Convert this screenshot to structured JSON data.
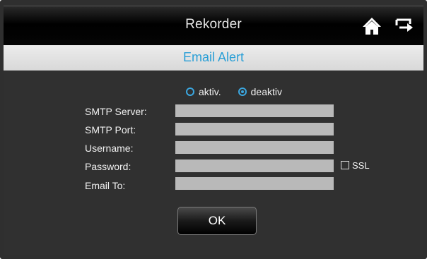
{
  "header": {
    "title": "Rekorder",
    "home_icon": "home-icon",
    "back_icon": "exit-icon"
  },
  "section": {
    "title": "Email Alert"
  },
  "mode": {
    "options": [
      "aktiv.",
      "deaktiv"
    ],
    "selected": "deaktiv"
  },
  "form": {
    "smtp_server": {
      "label": "SMTP Server:",
      "value": ""
    },
    "smtp_port": {
      "label": "SMTP Port:",
      "value": ""
    },
    "username": {
      "label": "Username:",
      "value": ""
    },
    "password": {
      "label": "Password:",
      "value": ""
    },
    "email_to": {
      "label": "Email To:",
      "value": ""
    },
    "ssl": {
      "label": "SSL",
      "checked": false
    }
  },
  "actions": {
    "ok_label": "OK"
  },
  "colors": {
    "accent": "#3ba7e0",
    "section_title": "#2a9fd6",
    "field_bg": "#b9b9b9"
  }
}
